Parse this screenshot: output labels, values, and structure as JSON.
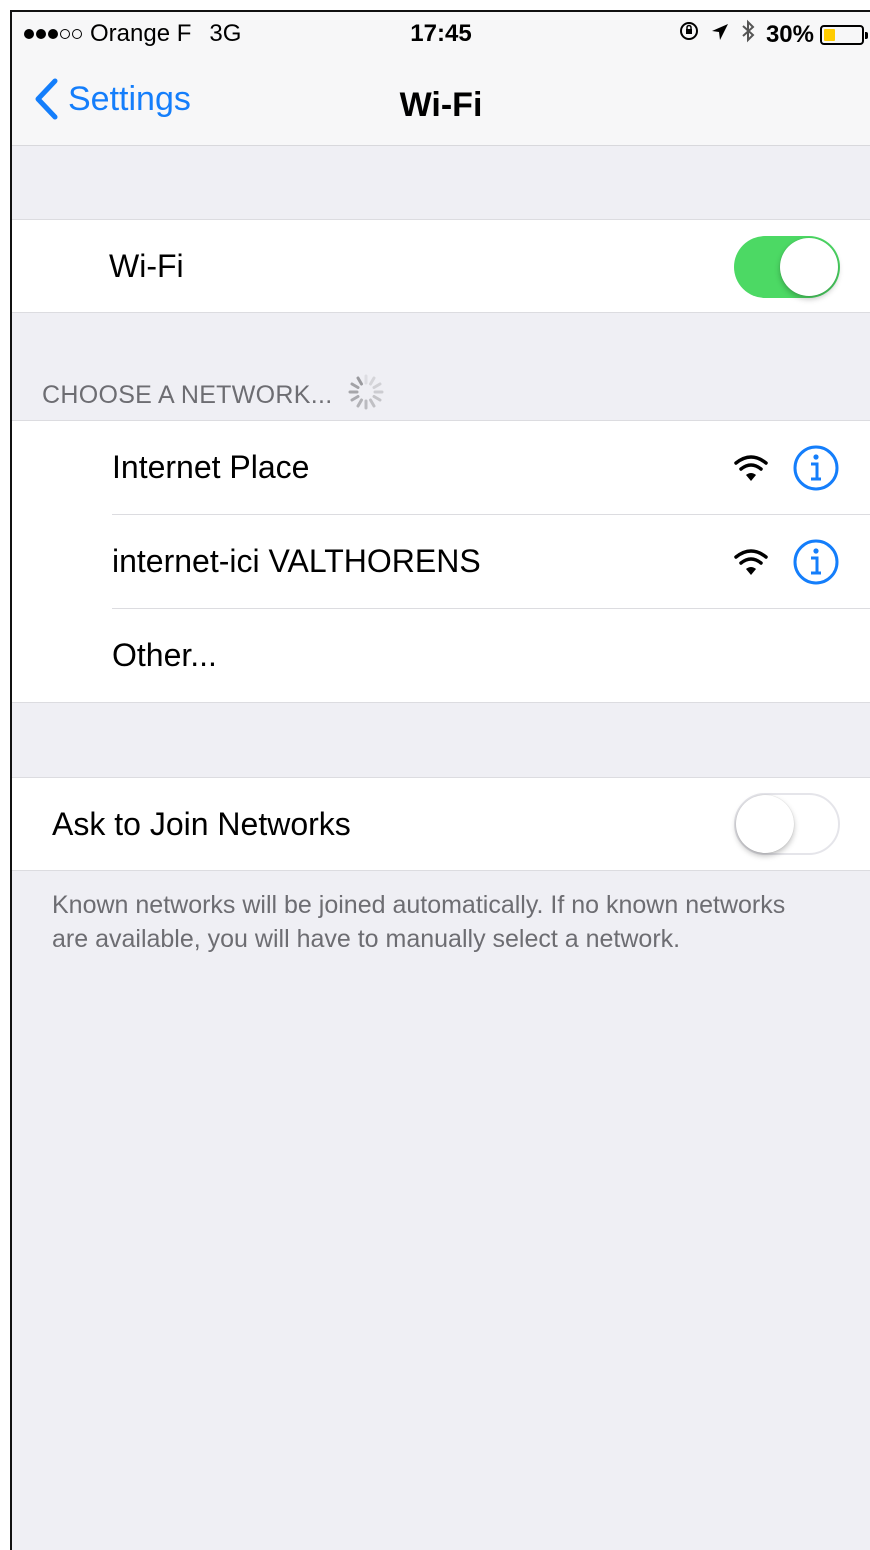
{
  "status_bar": {
    "carrier": "Orange F",
    "network": "3G",
    "time": "17:45",
    "battery": "30%",
    "battery_level": 0.3
  },
  "nav": {
    "back_label": "Settings",
    "title": "Wi-Fi"
  },
  "wifi_toggle": {
    "label": "Wi-Fi",
    "on": true
  },
  "networks_section": {
    "header": "CHOOSE A NETWORK...",
    "items": [
      {
        "name": "Internet Place"
      },
      {
        "name": "internet-ici VALTHORENS"
      },
      {
        "name": "Other..."
      }
    ]
  },
  "ask_to_join": {
    "label": "Ask to Join Networks",
    "on": false,
    "footer": "Known networks will be joined automatically. If no known networks are available, you will have to manually select a network."
  },
  "colors": {
    "accent": "#147efb",
    "toggle_on": "#4cd964",
    "background": "#efeff4",
    "battery": "#ffcc00"
  }
}
